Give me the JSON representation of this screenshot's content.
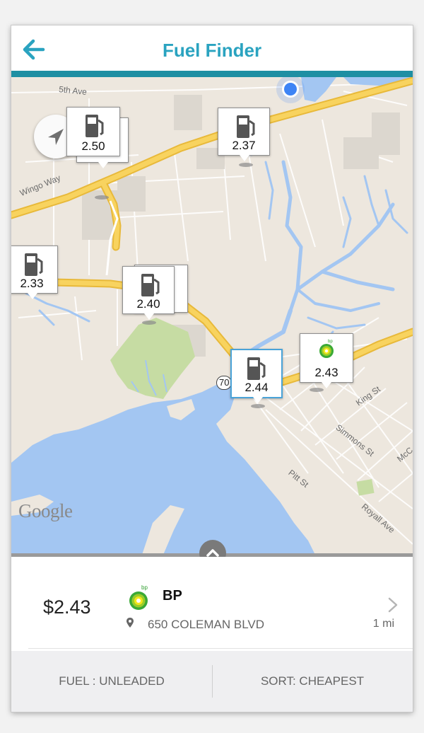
{
  "header": {
    "title": "Fuel Finder"
  },
  "map": {
    "streets": [
      "5th Ave",
      "Wingo Way",
      "King St",
      "Simmons St",
      "Pitt St",
      "Royall Ave",
      "McC"
    ],
    "highway_number": "70",
    "attribution": "Google",
    "markers": [
      {
        "price": "2.50",
        "brand": "pump"
      },
      {
        "price": "2.44",
        "brand": "pump"
      },
      {
        "price": "2.37",
        "brand": "pump"
      },
      {
        "price": "2.33",
        "brand": "pump"
      },
      {
        "price": "2.40",
        "brand": "pump"
      },
      {
        "price": "2.44",
        "brand": "pump",
        "selected": true
      },
      {
        "price": "2.43",
        "brand": "bp",
        "brand_label": "bp"
      }
    ]
  },
  "selected_station": {
    "price": "$2.43",
    "brand": "BP",
    "logo_text": "bp",
    "address": "650 COLEMAN BLVD",
    "distance": "1 mi"
  },
  "footer": {
    "fuel_label": "FUEL : UNLEADED",
    "sort_label": "SORT: CHEAPEST"
  },
  "colors": {
    "accent": "#2aa3c0",
    "header_bar": "#1e8fa3",
    "water": "#a3c6f2",
    "highway": "#f8d35f",
    "park": "#c6dca3",
    "land": "#ede7de"
  }
}
